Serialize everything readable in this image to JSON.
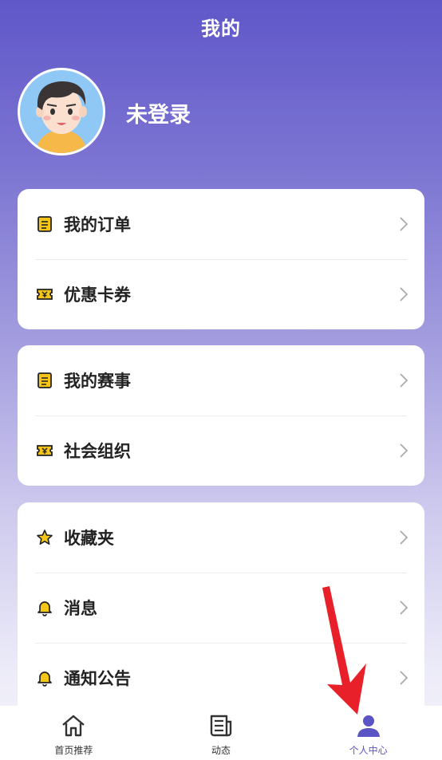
{
  "header": {
    "title": "我的"
  },
  "profile": {
    "username": "未登录"
  },
  "cards": [
    {
      "items": [
        {
          "label": "我的订单",
          "icon": "order-list-icon"
        },
        {
          "label": "优惠卡券",
          "icon": "coupon-ticket-icon"
        }
      ]
    },
    {
      "items": [
        {
          "label": "我的赛事",
          "icon": "event-list-icon"
        },
        {
          "label": "社会组织",
          "icon": "organization-ticket-icon"
        }
      ]
    },
    {
      "items": [
        {
          "label": "收藏夹",
          "icon": "star-icon"
        },
        {
          "label": "消息",
          "icon": "bell-icon"
        },
        {
          "label": "通知公告",
          "icon": "bell-icon"
        }
      ]
    }
  ],
  "tabbar": {
    "active_index": 2,
    "tabs": [
      {
        "label": "首页推荐",
        "icon": "home-icon"
      },
      {
        "label": "动态",
        "icon": "news-icon"
      },
      {
        "label": "个人中心",
        "icon": "person-icon"
      }
    ]
  },
  "colors": {
    "accent": "#5b54c4",
    "header_gradient_top": "#6057c9",
    "icon_yellow": "#f5c518",
    "annotation_arrow": "#e8202a"
  }
}
